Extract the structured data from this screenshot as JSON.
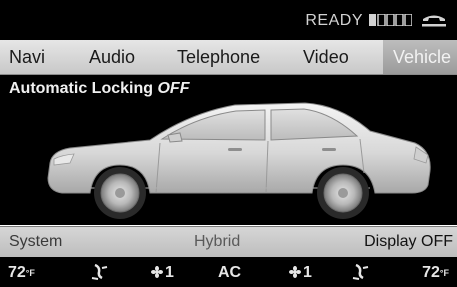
{
  "status_bar": {
    "ready_text": "READY",
    "signal_icon": "signal-strength-icon",
    "phone_icon": "phone-icon"
  },
  "main_menu": {
    "items": [
      {
        "label": "Navi",
        "active": false
      },
      {
        "label": "Audio",
        "active": false
      },
      {
        "label": "Telephone",
        "active": false
      },
      {
        "label": "Video",
        "active": false
      },
      {
        "label": "Vehicle",
        "active": true
      }
    ]
  },
  "content": {
    "setting_label": "Automatic Locking",
    "setting_value": "OFF",
    "image": "car-side-view"
  },
  "sub_menu": {
    "system": "System",
    "hybrid": "Hybrid",
    "display_off": "Display OFF",
    "colors": {
      "system": "#3a3a3a",
      "hybrid": "#5a5a5a",
      "display_off": "#111111"
    }
  },
  "climate": {
    "left_temp": "72",
    "left_unit": "°F",
    "left_fan": "1",
    "ac": "AC",
    "right_fan": "1",
    "right_temp": "72",
    "right_unit": "°F",
    "icons": [
      "airflow-icon",
      "fan-icon"
    ]
  },
  "colors": {
    "background_dark": "#000000",
    "menu_bg": "#d6d6d6",
    "active_text": "#f2f2f2",
    "text_light": "#e6e6e6"
  }
}
